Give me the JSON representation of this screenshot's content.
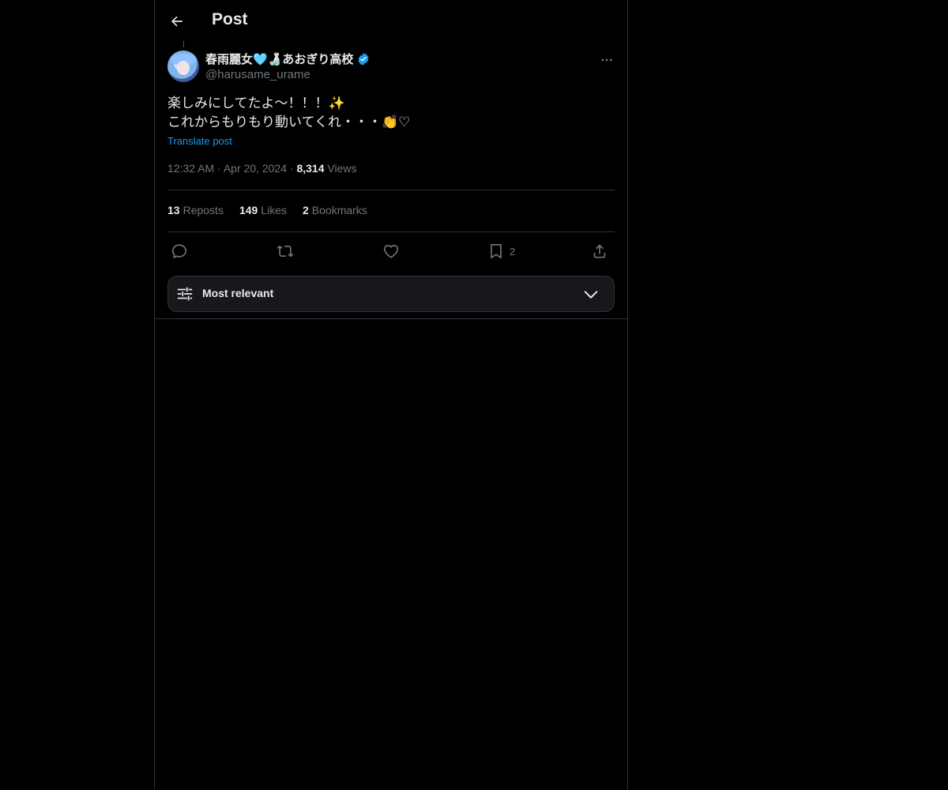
{
  "header": {
    "title": "Post"
  },
  "post": {
    "display_name": "春雨麗女🩵🍶あおぎり高校",
    "handle": "@harusame_urame",
    "lines": [
      "楽しみにしてたよ〜！！！✨",
      "これからもりもり動いてくれ・・・👏♡"
    ],
    "translate_label": "Translate post",
    "time": "12:32 AM",
    "date": "Apr 20, 2024",
    "views_count": "8,314",
    "views_label": "Views"
  },
  "stats": {
    "reposts_count": "13",
    "reposts_label": "Reposts",
    "likes_count": "149",
    "likes_label": "Likes",
    "bookmarks_count": "2",
    "bookmarks_label": "Bookmarks"
  },
  "actions": {
    "bookmark_count": "2"
  },
  "sort": {
    "label": "Most relevant"
  },
  "colors": {
    "background": "#000000",
    "accent": "#1d9bf0",
    "muted": "#71767b",
    "border": "#2f3336"
  }
}
